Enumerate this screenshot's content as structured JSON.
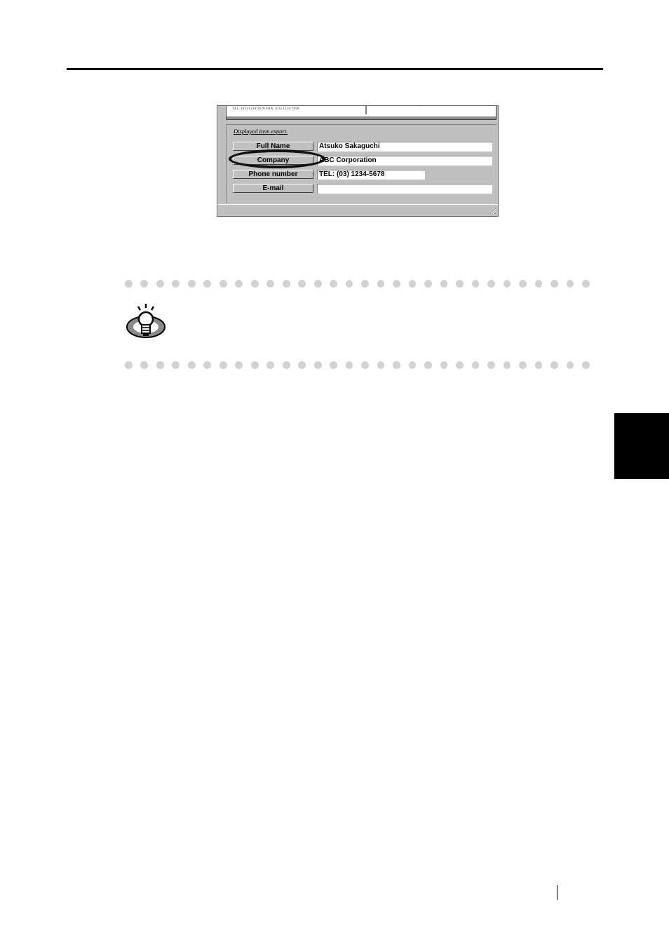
{
  "figure": {
    "preview_card_text": "TEL: (03) 1234-5678   FAX: (03) 1234-7890",
    "group_label": "Displayed item export.",
    "fields": [
      {
        "label": "Full Name",
        "value": "Atsuko Sakaguchi"
      },
      {
        "label": "Company",
        "value": "ABC Corporation"
      },
      {
        "label": "Phone number",
        "value": "TEL: (03) 1234-5678"
      },
      {
        "label": "E-mail",
        "value": ""
      }
    ],
    "highlighted_field": "Company"
  },
  "hint": {
    "icon": "lightbulb-hint-icon"
  },
  "colors": {
    "window_gray": "#c0c0c0",
    "dot_gray": "#d2d2d2",
    "tab_black": "#000000"
  }
}
